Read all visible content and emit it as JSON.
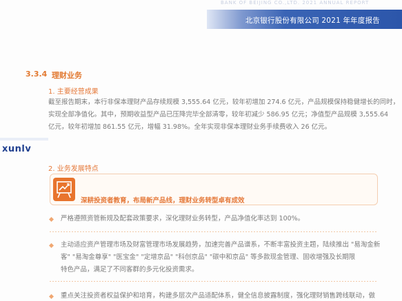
{
  "header": {
    "top_faint_text": "BANK OF BEIJING CO.,LTD. 2021 ANNUAL REPORT",
    "title": "北京银行股份有限公司 2021 年年度报告"
  },
  "watermark": "xunlv",
  "section": {
    "number": "3.3.4",
    "title": "理财业务"
  },
  "part1": {
    "title": "1. 主要经营成果",
    "lines": [
      "截至报告期末，本行非保本理财产品存续规模 3,555.64 亿元，较年初增加 274.6 亿元，产品规模保持稳健增长的同时，",
      "实现全部净值化。其中，预期收益型产品已压降完毕全部清零，较年初减少 586.95 亿元；净值型产品规模 3,555.64",
      "亿元，较年初增加 861.55 亿元，增幅 31.98%。全年实现非保本理财业务手续费收入 26 亿元。"
    ]
  },
  "part2": {
    "title": "2. 业务发展特点",
    "highlight": "深耕投资者教育，布局新产品线，理财业务转型卓有成效",
    "bullets": [
      {
        "lines": [
          "严格遵照资管新规及配套政策要求，深化理财业务转型，产品净值化率达到 100%。"
        ]
      },
      {
        "lines": [
          "主动适应资产管理市场及财富管理市场发展趋势，加速完善产品谱系，不断丰富投资主题，陆续推出 \"易淘金新",
          "客\" \"易淘金尊享\" \"医宝金\" \"定增京品\" \"科创京品\" \"碳中和京品\" 等多款现金管理、固收增强及长期限",
          "特色产品，满足了不同客群的多元化投资需求。"
        ]
      },
      {
        "lines": [
          "重点关注投资者权益保护和培育，构建多层次产品适配体系，健全信息披露制度，强化理财销售跨线联动，做"
        ]
      }
    ]
  },
  "colors": {
    "header_blue": "#2c56aa",
    "accent_orange": "#e5793a",
    "watermark_navy": "#1f3f8f"
  }
}
